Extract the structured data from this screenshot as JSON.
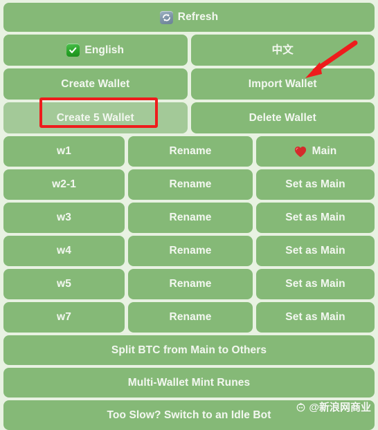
{
  "colors": {
    "page_background": "#e8f2e2",
    "button": "#85b977",
    "button_hover": "#a3c998",
    "button_text": "#f2f7ef",
    "annotation_red": "#ee1c1c"
  },
  "toolbar": {
    "refresh_label": "Refresh",
    "refresh_icon": "refresh-icon"
  },
  "language": {
    "english_label": "English",
    "english_icon": "green-check-icon",
    "chinese_label": "中文"
  },
  "actions": {
    "create_wallet": "Create Wallet",
    "import_wallet": "Import Wallet",
    "create_5_wallet": "Create 5 Wallet",
    "delete_wallet": "Delete Wallet"
  },
  "wallets": [
    {
      "name": "w1",
      "rename_label": "Rename",
      "main_label": "Main",
      "is_main": true,
      "main_icon": "heart-icon"
    },
    {
      "name": "w2-1",
      "rename_label": "Rename",
      "main_label": "Set as Main",
      "is_main": false,
      "main_icon": ""
    },
    {
      "name": "w3",
      "rename_label": "Rename",
      "main_label": "Set as Main",
      "is_main": false,
      "main_icon": ""
    },
    {
      "name": "w4",
      "rename_label": "Rename",
      "main_label": "Set as Main",
      "is_main": false,
      "main_icon": ""
    },
    {
      "name": "w5",
      "rename_label": "Rename",
      "main_label": "Set as Main",
      "is_main": false,
      "main_icon": ""
    },
    {
      "name": "w7",
      "rename_label": "Rename",
      "main_label": "Set as Main",
      "is_main": false,
      "main_icon": ""
    }
  ],
  "footer": {
    "split_btc": "Split BTC from Main to Others",
    "mint_runes": "Multi-Wallet Mint Runes",
    "idle_bot": "Too Slow? Switch to an Idle Bot"
  },
  "watermark": {
    "text": "@新浪网商业",
    "logo_icon": "sina-logo-icon"
  }
}
